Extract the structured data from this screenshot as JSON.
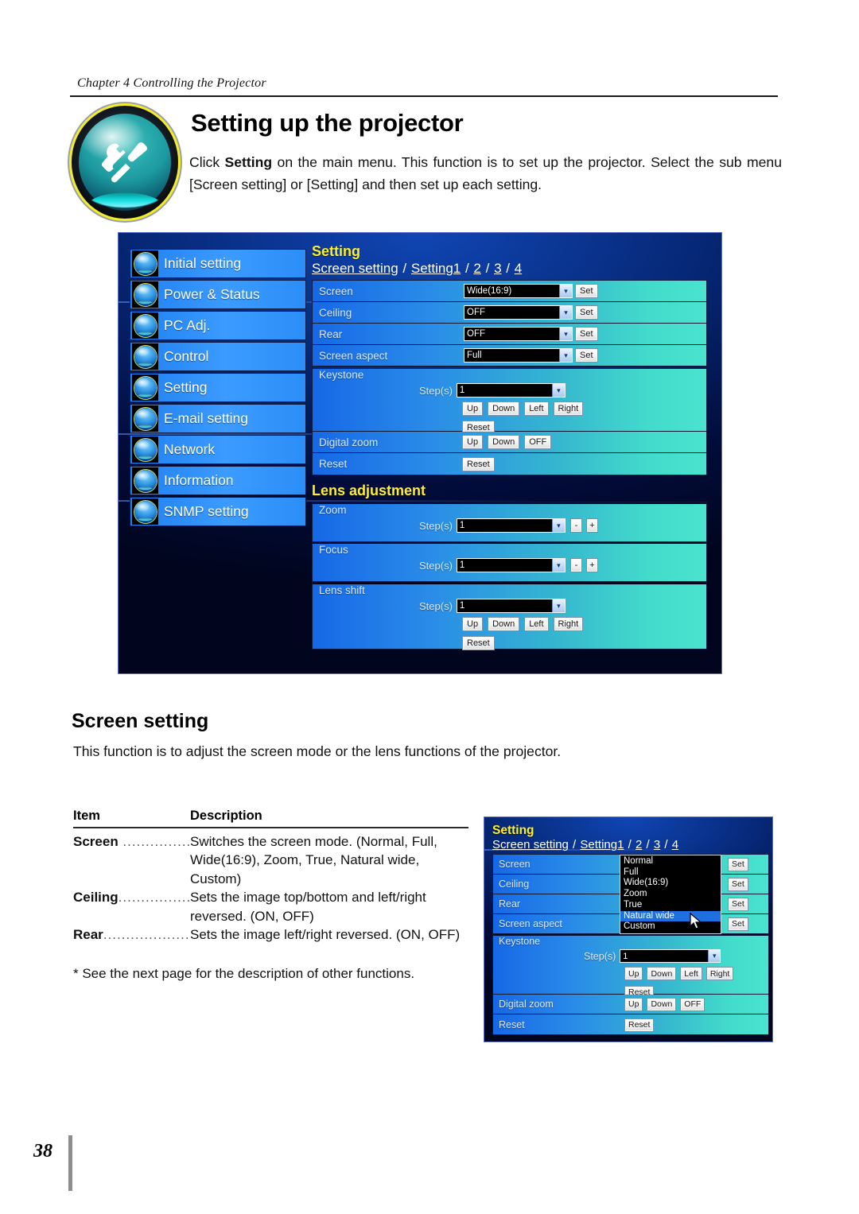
{
  "page": {
    "chapter": "Chapter 4 Controlling the Projector",
    "title": "Setting up the projector",
    "intro_prefix": "Click ",
    "intro_bold": "Setting",
    "intro_suffix": " on the main menu. This function is to set up the projector. Select the sub menu [Screen setting] or [Setting] and then set up each setting.",
    "folio": "38"
  },
  "section": {
    "heading": "Screen setting",
    "description": "This function is to adjust the screen mode or the lens functions of the projector."
  },
  "table": {
    "col_item": "Item",
    "col_description": "Description",
    "rows": [
      {
        "item": "Screen",
        "dots": " ....................",
        "description": "Switches the screen mode. (Normal, Full, Wide(16:9), Zoom, True, Natural wide, Custom)"
      },
      {
        "item": "Ceiling",
        "dots": "....................",
        "description": "Sets the image top/bottom and left/right reversed. (ON, OFF)"
      },
      {
        "item": "Rear",
        "dots": "........................",
        "description": "Sets the image left/right reversed. (ON, OFF)"
      }
    ],
    "note": "* See the next page for the description of other functions."
  },
  "ui": {
    "sidebar": {
      "items": [
        {
          "label": "Initial setting",
          "icon": "gear-orb-icon"
        },
        {
          "label": "Power & Status",
          "icon": "power-orb-icon"
        },
        {
          "label": "PC Adj.",
          "icon": "monitor-orb-icon"
        },
        {
          "label": "Control",
          "icon": "control-orb-icon"
        },
        {
          "label": "Setting",
          "icon": "tools-orb-icon"
        },
        {
          "label": "E-mail setting",
          "icon": "envelope-orb-icon"
        },
        {
          "label": "Network",
          "icon": "network-orb-icon"
        },
        {
          "label": "Information",
          "icon": "info-orb-icon"
        },
        {
          "label": "SNMP setting",
          "icon": "snmp-orb-icon"
        }
      ]
    },
    "panel": {
      "title": "Setting",
      "tabs": {
        "current": "Screen setting",
        "sep": " / ",
        "items": [
          "Setting1",
          "2",
          "3",
          "4"
        ]
      },
      "lens_title": "Lens adjustment",
      "set_label": "Set",
      "reset_label": "Reset",
      "steps_label": "Step(s)",
      "up_label": "Up",
      "down_label": "Down",
      "left_label": "Left",
      "right_label": "Right",
      "off_label": "OFF",
      "minus_label": "-",
      "plus_label": "+",
      "chevron": "▾",
      "rows": {
        "screen": {
          "label": "Screen",
          "value": "Wide(16:9)"
        },
        "ceiling": {
          "label": "Ceiling",
          "value": "OFF"
        },
        "rear": {
          "label": "Rear",
          "value": "OFF"
        },
        "screen_aspect": {
          "label": "Screen aspect",
          "value": "Full"
        },
        "keystone": {
          "label": "Keystone",
          "value": "1"
        },
        "digital_zoom": {
          "label": "Digital zoom"
        },
        "reset": {
          "label": "Reset"
        },
        "zoom": {
          "label": "Zoom",
          "value": "1"
        },
        "focus": {
          "label": "Focus",
          "value": "1"
        },
        "lens_shift": {
          "label": "Lens shift",
          "value": "1"
        }
      }
    },
    "dropdown_shot": {
      "title": "Setting",
      "rows": {
        "screen": {
          "label": "Screen",
          "value": "Normal"
        },
        "ceiling": {
          "label": "Ceiling"
        },
        "rear": {
          "label": "Rear"
        },
        "screen_aspect": {
          "label": "Screen aspect"
        },
        "keystone": {
          "label": "Keystone",
          "value": "1"
        },
        "digital_zoom": {
          "label": "Digital zoom"
        },
        "reset": {
          "label": "Reset"
        }
      },
      "options": [
        "Normal",
        "Full",
        "Wide(16:9)",
        "Zoom",
        "True",
        "Natural wide",
        "Custom"
      ],
      "selected_option": "Natural wide"
    }
  },
  "colors": {
    "panel_title": "#ffef2b",
    "sidebar_item": "#2b8ef7",
    "row_gradient_start": "#1668e6",
    "row_gradient_end": "#49e3cf",
    "highlight": "#1f6fe0"
  }
}
